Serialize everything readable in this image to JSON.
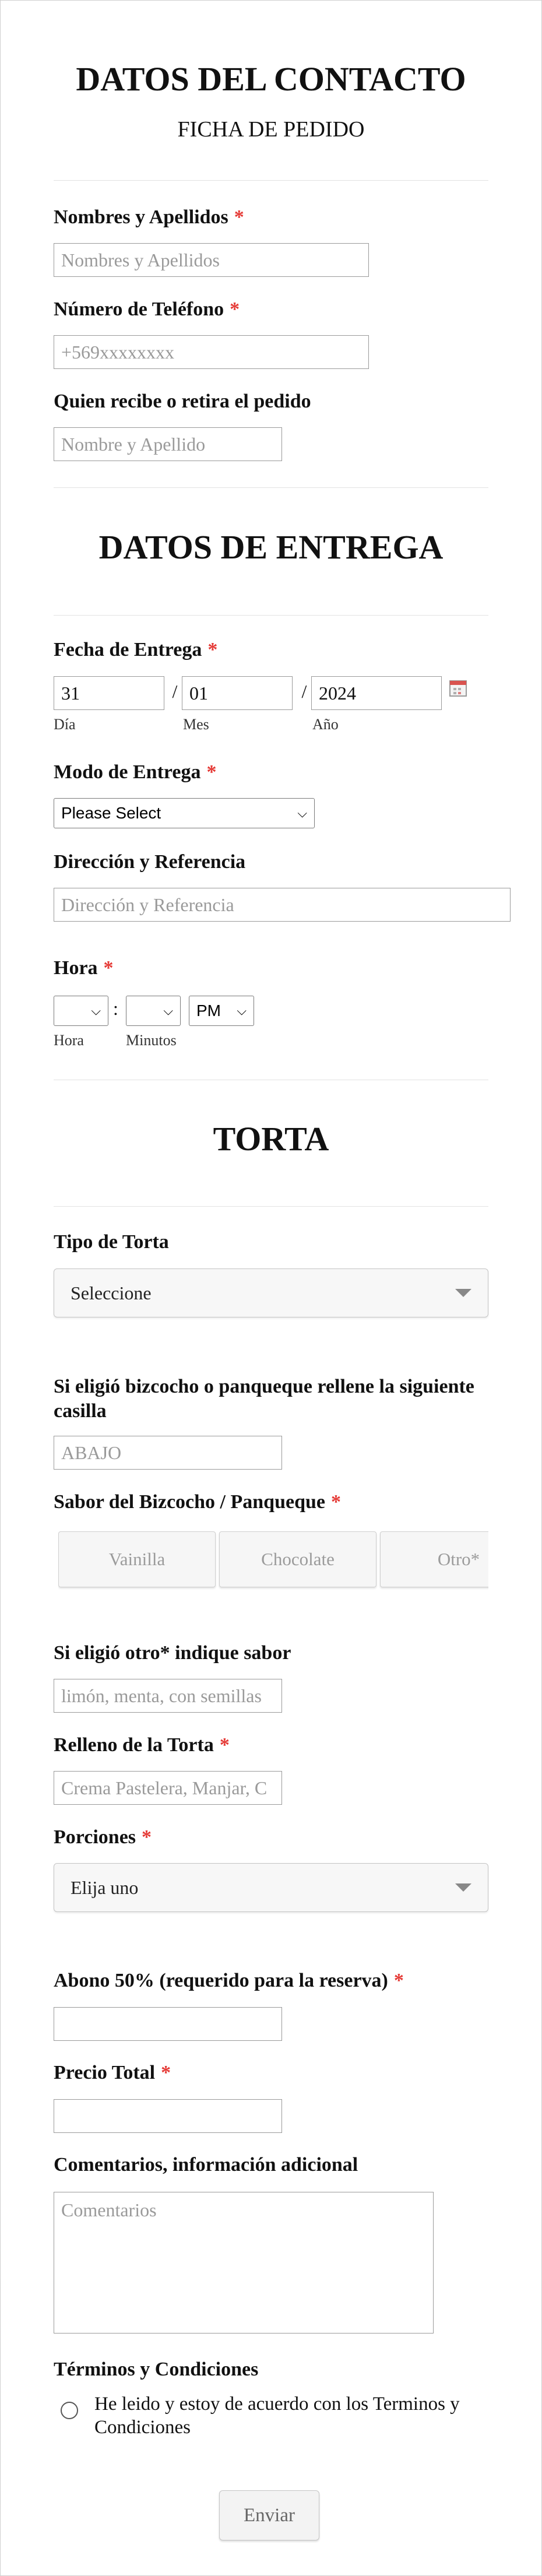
{
  "contacto": {
    "title": "DATOS DEL CONTACTO",
    "subtitle": "FICHA DE PEDIDO",
    "nombres_label": "Nombres y Apellidos",
    "nombres_placeholder": "Nombres y Apellidos",
    "telefono_label": "Número de Teléfono",
    "telefono_placeholder": "+569xxxxxxxx",
    "recibe_label": "Quien recibe o retira el pedido",
    "recibe_placeholder": "Nombre y Apellido",
    "required_mark": "*"
  },
  "entrega": {
    "title": "DATOS DE ENTREGA",
    "fecha_label": "Fecha de Entrega",
    "day_value": "31",
    "month_value": "01",
    "year_value": "2024",
    "date_separator": "/",
    "day_label": "Día",
    "month_label": "Mes",
    "year_label": "Año",
    "modo_label": "Modo de Entrega",
    "modo_value": "Please Select",
    "direccion_label": "Dirección y Referencia",
    "direccion_placeholder": "Dirección y Referencia",
    "hora_label": "Hora",
    "hora_separator": ":",
    "ampm_value": "PM",
    "hora_sublabel": "Hora",
    "minutos_sublabel": "Minutos"
  },
  "torta": {
    "title": "TORTA",
    "tipo_label": "Tipo de Torta",
    "tipo_value": "Seleccione",
    "bizcocho_label": "Si eligió bizcocho o panqueque rellene la siguiente casilla",
    "bizcocho_placeholder": "ABAJO",
    "sabor_label": "Sabor del Bizcocho / Panqueque",
    "sabores": [
      "Vainilla",
      "Chocolate",
      "Otro*"
    ],
    "otro_label": "Si eligió otro* indique sabor",
    "otro_placeholder": "limón, menta, con semillas",
    "relleno_label": "Relleno de la Torta",
    "relleno_placeholder": "Crema Pastelera, Manjar, C",
    "porciones_label": "Porciones",
    "porciones_value": "Elija uno",
    "abono_label": "Abono 50% (requerido para la reserva)",
    "precio_label": "Precio Total",
    "comentarios_label": "Comentarios, información adicional",
    "comentarios_placeholder": "Comentarios",
    "terminos_label": "Términos y Condiciones",
    "terminos_text": "He leido y estoy de acuerdo con los Terminos y Condiciones",
    "submit_label": "Enviar"
  },
  "colors": {
    "required": "#e53935",
    "divider": "#e2e2e2",
    "placeholder": "#9a9a9a"
  }
}
